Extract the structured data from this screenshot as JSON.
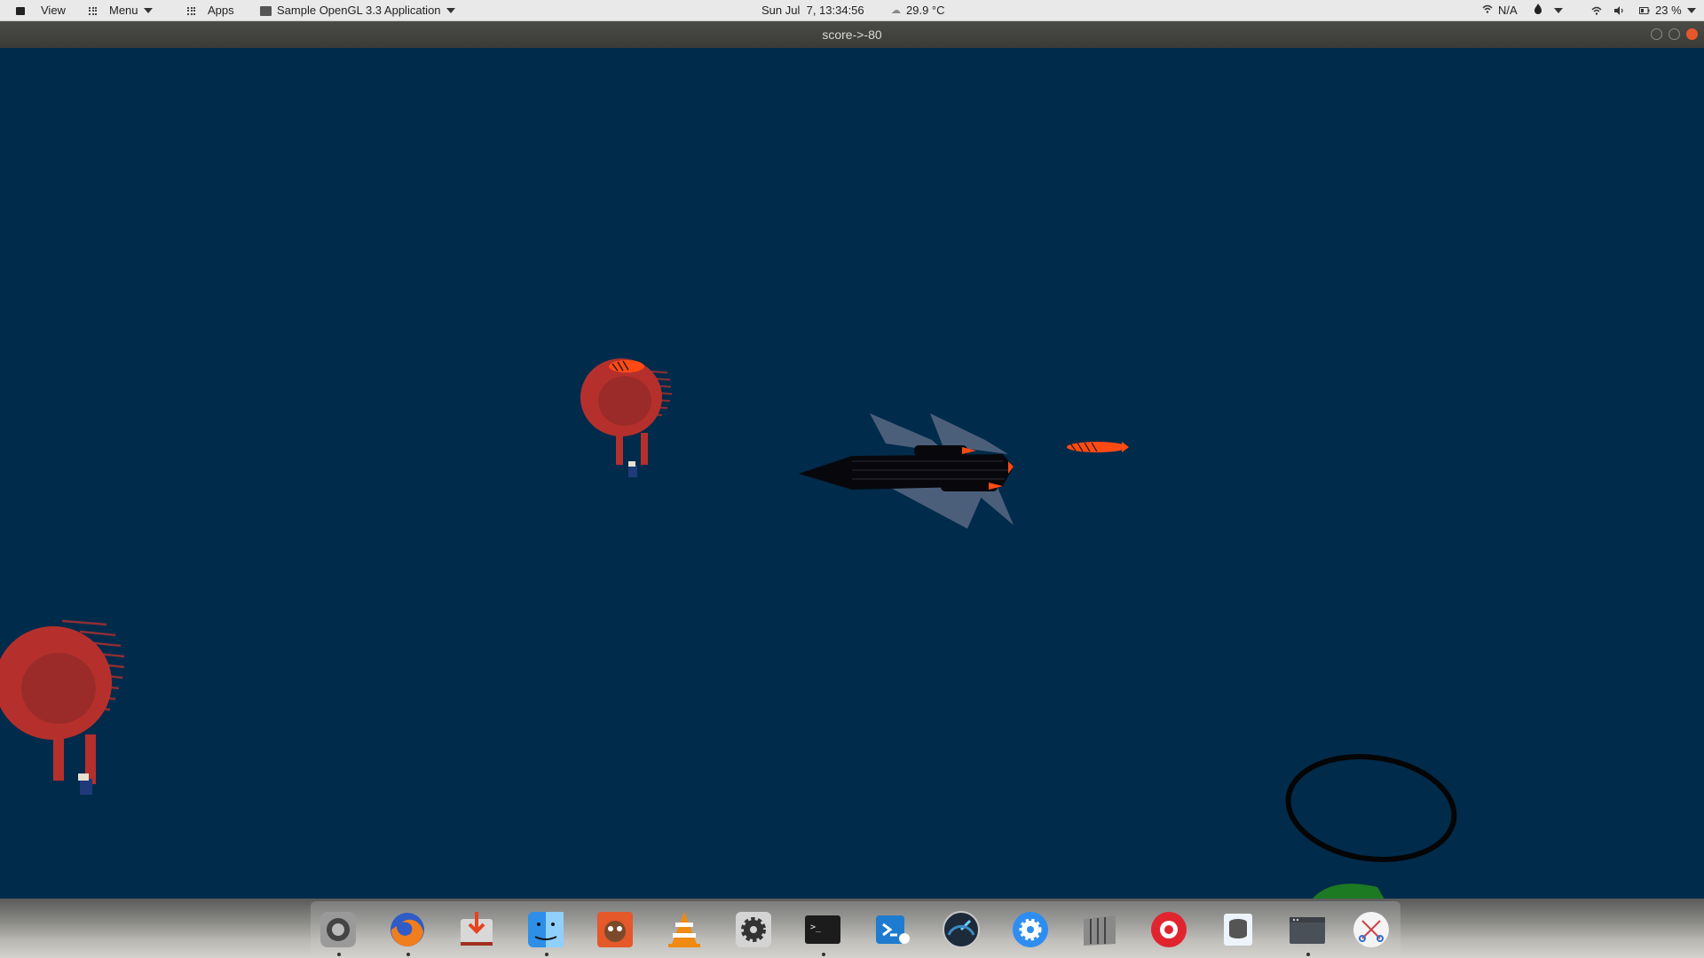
{
  "top_panel": {
    "view_label": "View",
    "menu_label": "Menu",
    "apps_label": "Apps",
    "app_title": "Sample OpenGL 3.3 Application",
    "datetime": "Sun Jul  7, 13:34:56",
    "temperature": "29.9 °C",
    "network": "N/A",
    "battery": "23 %"
  },
  "window": {
    "title": "score->-80"
  },
  "dock": {
    "apps": [
      "system-settings-icon",
      "firefox-icon",
      "downloader-icon",
      "finder-icon",
      "gimp-icon",
      "vlc-icon",
      "settings-gear-icon",
      "terminal-icon",
      "vscode-icon",
      "speedometer-icon",
      "preferences-icon",
      "keyboard-icon",
      "lifebuoy-icon",
      "database-icon",
      "window-icon",
      "scissors-icon"
    ]
  },
  "colors": {
    "sky": "#002b4b",
    "balloon": "#b5302c",
    "flame": "#ff4a14"
  }
}
